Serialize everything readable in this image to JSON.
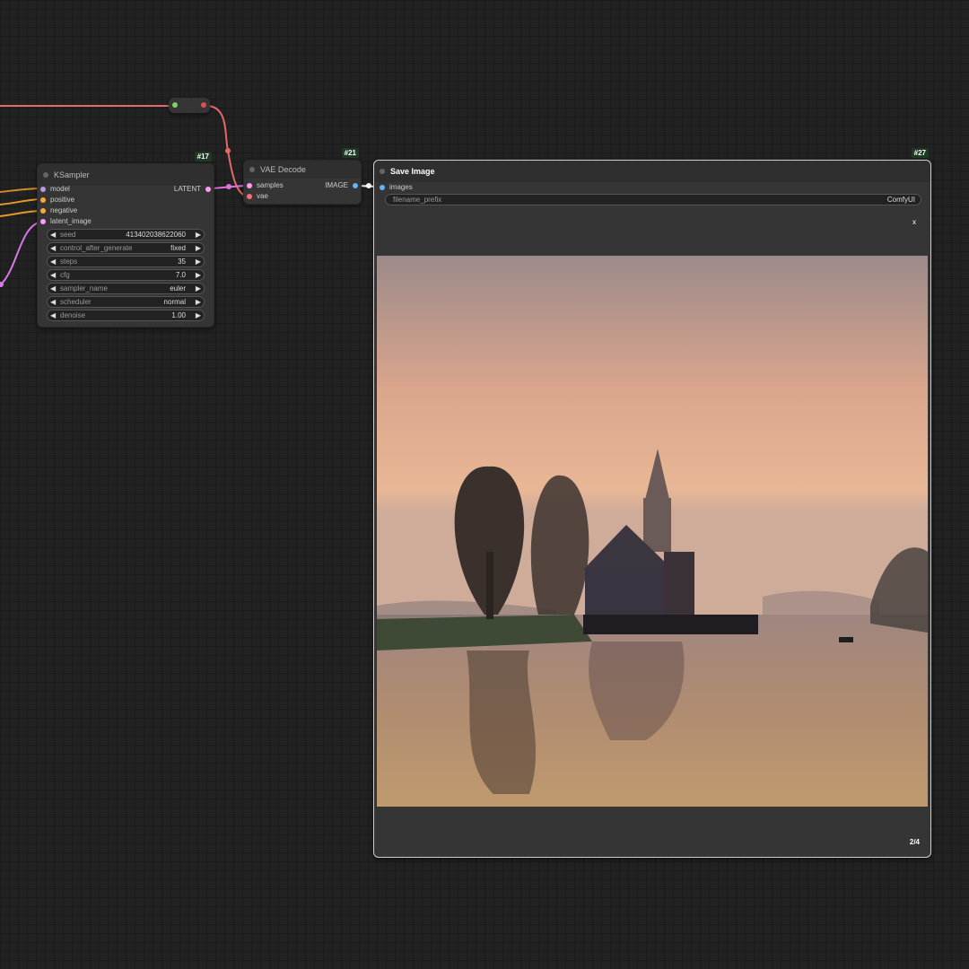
{
  "colors": {
    "canvas": "#222222",
    "model": "#b39ddb",
    "conditioning": "#ffa931",
    "latent": "#ff9cf9",
    "vae": "#ff6e6e",
    "image": "#64b5f6"
  },
  "ksampler": {
    "badge": "#17",
    "title": "KSampler",
    "inputs": [
      "model",
      "positive",
      "negative",
      "latent_image"
    ],
    "output": "LATENT",
    "widgets": [
      {
        "label": "seed",
        "value": "413402038622060"
      },
      {
        "label": "control_after_generate",
        "value": "fixed"
      },
      {
        "label": "steps",
        "value": "35"
      },
      {
        "label": "cfg",
        "value": "7.0"
      },
      {
        "label": "sampler_name",
        "value": "euler"
      },
      {
        "label": "scheduler",
        "value": "normal"
      },
      {
        "label": "denoise",
        "value": "1.00"
      }
    ],
    "arrow_left": "◀",
    "arrow_right": "▶"
  },
  "vae_decode": {
    "badge": "#21",
    "title": "VAE Decode",
    "inputs": [
      "samples",
      "vae"
    ],
    "output": "IMAGE"
  },
  "save_image": {
    "badge": "#27",
    "title": "Save Image",
    "input": "images",
    "widget": {
      "label": "filename_prefix",
      "value": "ComfyUI"
    },
    "close": "x",
    "counter": "2/4",
    "preview_icon": "generated-landscape-image"
  }
}
